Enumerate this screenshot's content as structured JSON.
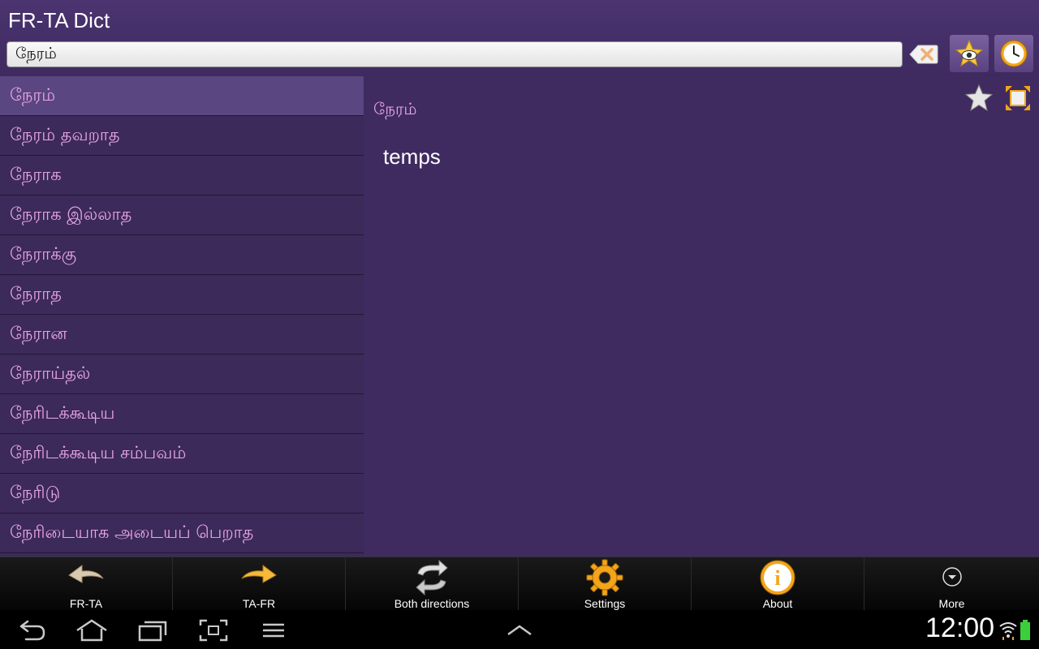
{
  "app": {
    "title": "FR-TA Dict"
  },
  "search": {
    "value": "நேரம்"
  },
  "toolbar": {
    "icons": [
      "clear-text-icon",
      "favorites-eye-icon",
      "history-clock-icon"
    ]
  },
  "word_list": [
    "நேரம்",
    "நேரம் தவறாத",
    "நேராக",
    "நேராக இல்லாத",
    "நேராக்கு",
    "நேராத",
    "நேரான",
    "நேராய்தல்",
    "நேரிடக்கூடிய",
    "நேரிடக்கூடிய சம்பவம்",
    "நேரிடு",
    "நேரிடையாக அடையப் பெறாத"
  ],
  "selected_index": 0,
  "detail": {
    "headword": "நேரம்",
    "translation": "temps"
  },
  "actions": [
    {
      "label": "FR-TA",
      "icon": "back-arrow-icon"
    },
    {
      "label": "TA-FR",
      "icon": "forward-arrow-icon"
    },
    {
      "label": "Both directions",
      "icon": "swap-arrows-icon"
    },
    {
      "label": "Settings",
      "icon": "gear-icon"
    },
    {
      "label": "About",
      "icon": "info-icon"
    },
    {
      "label": "More",
      "icon": "more-dropdown-icon"
    }
  ],
  "status": {
    "time": "12:00"
  },
  "colors": {
    "accent": "#e9a6e6",
    "background": "#3f2b60",
    "title_bar": "#4b3470"
  }
}
